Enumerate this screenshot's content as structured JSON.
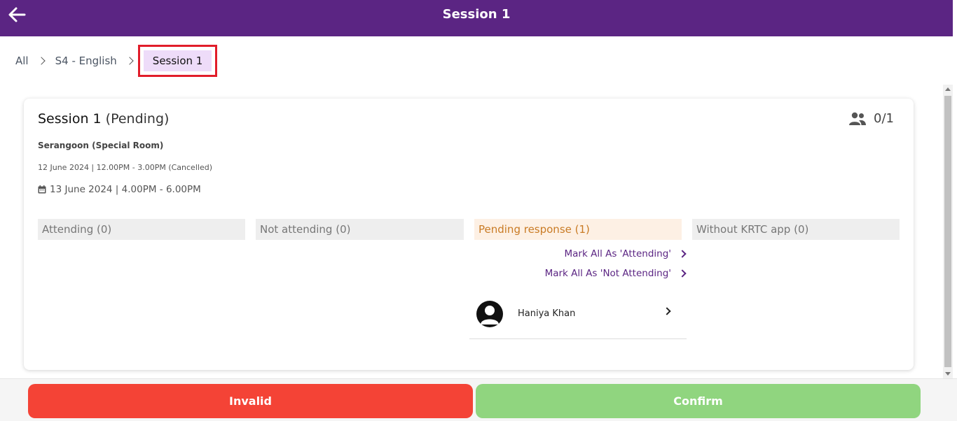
{
  "header": {
    "title": "Session 1"
  },
  "breadcrumb": {
    "items": [
      "All",
      "S4 - English"
    ],
    "active": "Session 1"
  },
  "session": {
    "name": "Session 1",
    "status": "(Pending)",
    "count": "0/1",
    "location": "Serangoon (Special Room)",
    "cancelled_slot": "12 June 2024 | 12.00PM - 3.00PM (Cancelled)",
    "new_slot": "13 June 2024 | 4.00PM - 6.00PM"
  },
  "columns": {
    "attending": "Attending (0)",
    "not_attending": "Not attending (0)",
    "pending": "Pending response (1)",
    "without_app": "Without KRTC app (0)"
  },
  "actions": {
    "mark_attending": "Mark All As 'Attending'",
    "mark_not_attending": "Mark All As 'Not Attending'"
  },
  "pending_people": [
    {
      "name": "Haniya Khan"
    }
  ],
  "footer": {
    "invalid_label": "Invalid",
    "confirm_label": "Confirm"
  },
  "colors": {
    "brand": "#5b2583",
    "invalid": "#f44336",
    "confirm": "#90d57f",
    "pending_text": "#c97b25"
  }
}
